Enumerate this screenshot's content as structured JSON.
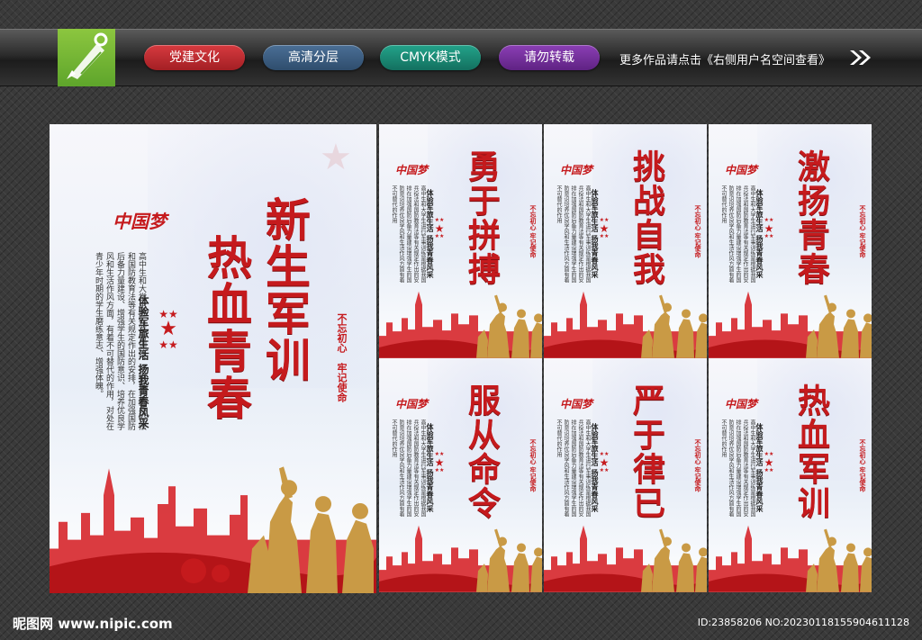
{
  "header": {
    "logo_icon": "pen-nib-icon",
    "tags": [
      "党建文化",
      "高清分层",
      "CMYK模式",
      "请勿转载"
    ],
    "tag_colors": [
      "#c42a2f",
      "#3d5c7f",
      "#1a8a74",
      "#742fa0"
    ],
    "more_text": "更多作品请点击《右侧用户名空间查看》",
    "arrow_icon": "double-chevron-right-icon"
  },
  "main_poster": {
    "title_line1": "新生军训",
    "title_line2": "热血青春",
    "china_dream": "中国梦",
    "subtitle": "体验军旅生活  扬我青春风采",
    "body": "高中生和大学生进行军事训练，是根据我国兵役法和国防教育法等有关规定作出的安排，在加强国防后备力量建设、增强学生的国防意识、培养优良学风和生活作风方面，有着不可替代的作用，对处在青少年时期的学生磨练意志、增强体魄。",
    "slogan_1": "不忘初心",
    "slogan_2": "牢记使命"
  },
  "small_posters": [
    {
      "title": "勇于拼搏"
    },
    {
      "title": "挑战自我"
    },
    {
      "title": "激扬青春"
    },
    {
      "title": "服从命令"
    },
    {
      "title": "严于律已"
    },
    {
      "title": "热血军训"
    }
  ],
  "small_common": {
    "subtitle": "体验军旅生活  扬我青春风采",
    "body": "高中生和大学生进行军事训练是根据我国兵役法和国防教育法等有关规定作出的安排在加强国防后备力量建设增强学生的国防意识培养优良学风和生活作风方面有着不可替代的作用",
    "slogan": "不忘初心  牢记使命"
  },
  "footer": {
    "site": "昵图网 www.nipic.com",
    "id_text": "ID:23858206 NO:20230118155904611128"
  },
  "colors": {
    "accent_red": "#c51a1d",
    "background": "#3a3a3a"
  }
}
